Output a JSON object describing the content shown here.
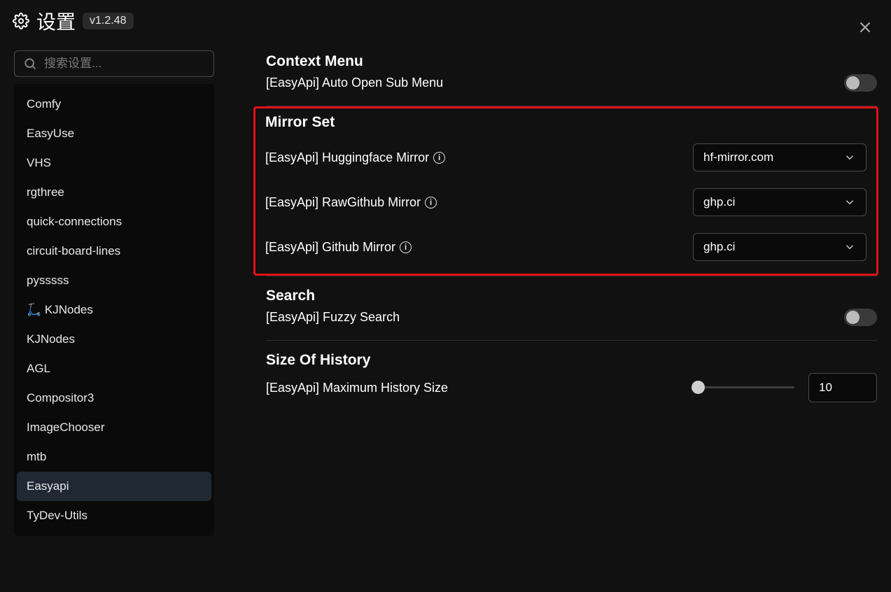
{
  "header": {
    "title": "设置",
    "version": "v1.2.48"
  },
  "search": {
    "placeholder": "搜索设置..."
  },
  "sidebar": {
    "items": [
      {
        "label": "Comfy",
        "active": false
      },
      {
        "label": "EasyUse",
        "active": false
      },
      {
        "label": "VHS",
        "active": false
      },
      {
        "label": "rgthree",
        "active": false
      },
      {
        "label": "quick-connections",
        "active": false
      },
      {
        "label": "circuit-board-lines",
        "active": false
      },
      {
        "label": "pysssss",
        "active": false
      },
      {
        "label": "🛴 KJNodes",
        "active": false
      },
      {
        "label": "KJNodes",
        "active": false
      },
      {
        "label": "AGL",
        "active": false
      },
      {
        "label": "Compositor3",
        "active": false
      },
      {
        "label": "ImageChooser",
        "active": false
      },
      {
        "label": "mtb",
        "active": false
      },
      {
        "label": "Easyapi",
        "active": true
      },
      {
        "label": "TyDev-Utils",
        "active": false
      }
    ]
  },
  "sections": {
    "context": {
      "title": "Context Menu",
      "autoOpen": {
        "label": "[EasyApi] Auto Open Sub Menu",
        "value": false
      }
    },
    "mirror": {
      "title": "Mirror Set",
      "hf": {
        "label": "[EasyApi] Huggingface Mirror",
        "value": "hf-mirror.com"
      },
      "rawgithub": {
        "label": "[EasyApi] RawGithub Mirror",
        "value": "ghp.ci"
      },
      "github": {
        "label": "[EasyApi] Github Mirror",
        "value": "ghp.ci"
      }
    },
    "search": {
      "title": "Search",
      "fuzzy": {
        "label": "[EasyApi] Fuzzy Search",
        "value": false
      }
    },
    "history": {
      "title": "Size Of History",
      "max": {
        "label": "[EasyApi] Maximum History Size",
        "value": "10"
      }
    }
  }
}
